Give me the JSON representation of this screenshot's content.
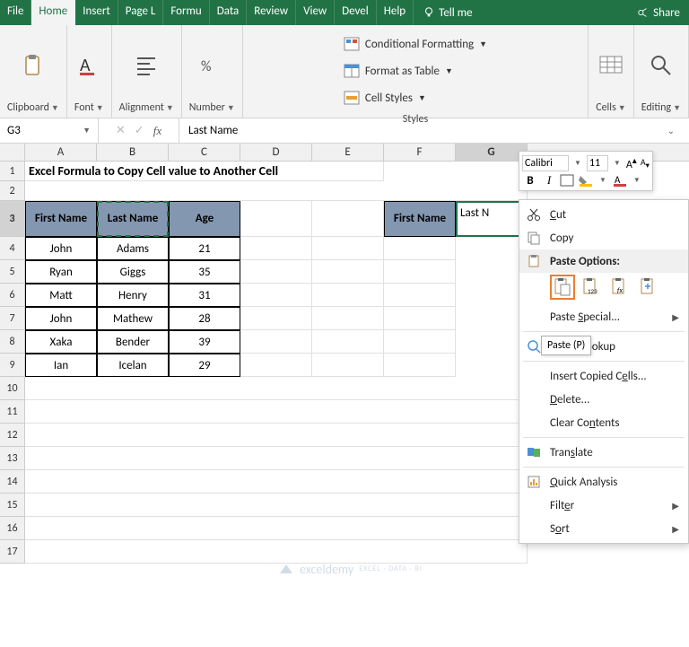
{
  "tabs": [
    "File",
    "Home",
    "Insert",
    "Page L",
    "Formu",
    "Data",
    "Review",
    "View",
    "Devel",
    "Help"
  ],
  "active_tab": "Home",
  "tellme": "Tell me",
  "share": "Share",
  "ribbon": {
    "clipboard": "Clipboard",
    "font": "Font",
    "alignment": "Alignment",
    "number": "Number",
    "styles": "Styles",
    "cells": "Cells",
    "editing": "Editing",
    "cond_fmt": "Conditional Formatting",
    "fmt_table": "Format as Table",
    "cell_styles": "Cell Styles"
  },
  "namebox": "G3",
  "formula": "Last Name",
  "cols": [
    "A",
    "B",
    "C",
    "D",
    "E",
    "F",
    "G"
  ],
  "title": "Excel Formula to Copy Cell value to Another Cell",
  "headers": {
    "first": "First Name",
    "last": "Last Name",
    "age": "Age"
  },
  "data": [
    {
      "first": "John",
      "last": "Adams",
      "age": "21"
    },
    {
      "first": "Ryan",
      "last": "Giggs",
      "age": "35"
    },
    {
      "first": "Matt",
      "last": "Henry",
      "age": "31"
    },
    {
      "first": "John",
      "last": "Mathew",
      "age": "28"
    },
    {
      "first": "Xaka",
      "last": "Bender",
      "age": "39"
    },
    {
      "first": "Ian",
      "last": "Icelan",
      "age": "29"
    }
  ],
  "paste_target": {
    "first": "First Name",
    "last": "Last N"
  },
  "mini": {
    "font": "Calibri",
    "size": "11"
  },
  "ctx": {
    "cut": "Cut",
    "copy": "Copy",
    "paste_opts": "Paste Options:",
    "paste_special": "Paste Special...",
    "smart": "Smart Lookup",
    "insert": "Insert Copied Cells...",
    "delete": "Delete...",
    "clear": "Clear Contents",
    "translate": "Translate",
    "quick": "Quick Analysis",
    "filter": "Filter",
    "sort": "Sort"
  },
  "tooltip": "Paste (P)",
  "watermark": "exceldemy"
}
